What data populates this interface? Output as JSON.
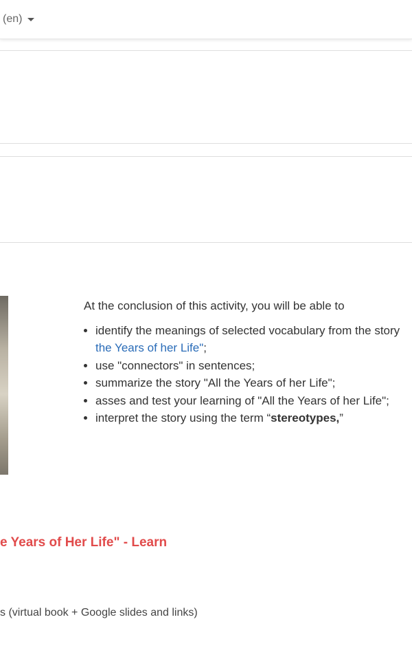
{
  "header": {
    "language_label": "(en)"
  },
  "objectives": {
    "intro": "At the conclusion of this activity, you will be able to",
    "items": [
      {
        "text": "identify the meanings of selected vocabulary from the story ",
        "link": "the Years of her Life\"",
        "suffix": ";"
      },
      {
        "text": "use  \"connectors\" in sentences;"
      },
      {
        "text": "summarize the story \"All the Years of her Life\";"
      },
      {
        "text": "asses and test your learning of \"All the Years of her Life\";"
      },
      {
        "text": "interpret the story using the term “",
        "bold": "stereotypes,",
        "suffix": "”"
      }
    ]
  },
  "activity": {
    "title": "e Years of Her Life\" - Learn"
  },
  "resource": {
    "text": "s (virtual book + Google slides and links)"
  },
  "colors": {
    "accent_red": "#e14b4b",
    "link_blue": "#2a6cb8"
  }
}
